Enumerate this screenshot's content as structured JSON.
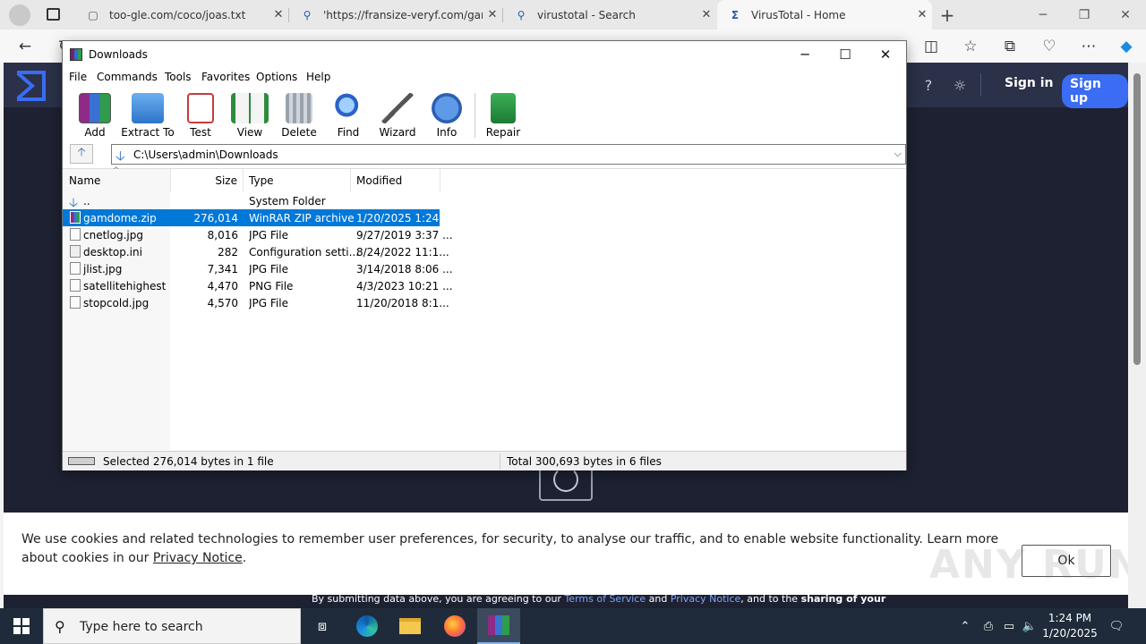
{
  "browser": {
    "tabs": [
      {
        "title": "too-gle.com/coco/joas.txt",
        "icon": "page-icon"
      },
      {
        "title": "'https://fransize-veryf.com/gam",
        "icon": "search-icon"
      },
      {
        "title": "virustotal - Search",
        "icon": "search-icon"
      },
      {
        "title": "VirusTotal - Home",
        "icon": "virustotal-icon"
      }
    ],
    "new_tab_label": "+",
    "nav": {
      "back": "back-icon",
      "refresh": "refresh-icon"
    }
  },
  "virustotal": {
    "sign_in": "Sign in",
    "sign_up": "Sign up",
    "submit_note_pre": "By submitting data above, you are agreeing to our ",
    "terms": "Terms of Service",
    "and": " and ",
    "privacy": "Privacy Notice",
    "submit_note_post": ", and to the ",
    "sharing": "sharing of your",
    "cookie_text": "We use cookies and related technologies to remember user preferences, for security, to analyse our traffic, and to enable website functionality. Learn more about cookies in our ",
    "cookie_link": "Privacy Notice",
    "cookie_end": ".",
    "cookie_ok": "Ok",
    "colors": {
      "header": "#2a3148",
      "body": "#1d2131",
      "accent": "#3a6cf4"
    }
  },
  "watermark": "ANY RUN",
  "winrar": {
    "title": "Downloads",
    "menu": [
      "File",
      "Commands",
      "Tools",
      "Favorites",
      "Options",
      "Help"
    ],
    "toolbar": [
      {
        "label": "Add",
        "icon": "add-archive-icon"
      },
      {
        "label": "Extract To",
        "icon": "extract-folder-icon"
      },
      {
        "label": "Test",
        "icon": "test-checklist-icon"
      },
      {
        "label": "View",
        "icon": "view-book-icon"
      },
      {
        "label": "Delete",
        "icon": "trash-icon"
      },
      {
        "label": "Find",
        "icon": "magnifier-icon"
      },
      {
        "label": "Wizard",
        "icon": "wand-icon"
      },
      {
        "label": "Info",
        "icon": "info-icon"
      },
      {
        "label": "Repair",
        "icon": "repair-icon"
      }
    ],
    "path": "C:\\Users\\admin\\Downloads",
    "columns": [
      "Name",
      "Size",
      "Type",
      "Modified"
    ],
    "files": [
      {
        "name": "..",
        "size": "",
        "type": "System Folder",
        "modified": ""
      },
      {
        "name": "gamdome.zip",
        "size": "276,014",
        "type": "WinRAR ZIP archive",
        "modified": "1/20/2025 1:24 ..."
      },
      {
        "name": "cnetlog.jpg",
        "size": "8,016",
        "type": "JPG File",
        "modified": "9/27/2019 3:37 ..."
      },
      {
        "name": "desktop.ini",
        "size": "282",
        "type": "Configuration setti...",
        "modified": "8/24/2022 11:1..."
      },
      {
        "name": "jlist.jpg",
        "size": "7,341",
        "type": "JPG File",
        "modified": "3/14/2018 8:06 ..."
      },
      {
        "name": "satellitehighest....",
        "size": "4,470",
        "type": "PNG File",
        "modified": "4/3/2023 10:21 ..."
      },
      {
        "name": "stopcold.jpg",
        "size": "4,570",
        "type": "JPG File",
        "modified": "11/20/2018 8:1..."
      }
    ],
    "selected_index": 1,
    "status_left": "Selected 276,014 bytes in 1 file",
    "status_right": "Total 300,693 bytes in 6 files"
  },
  "taskbar": {
    "search_placeholder": "Type here to search",
    "time": "1:24 PM",
    "date": "1/20/2025"
  }
}
